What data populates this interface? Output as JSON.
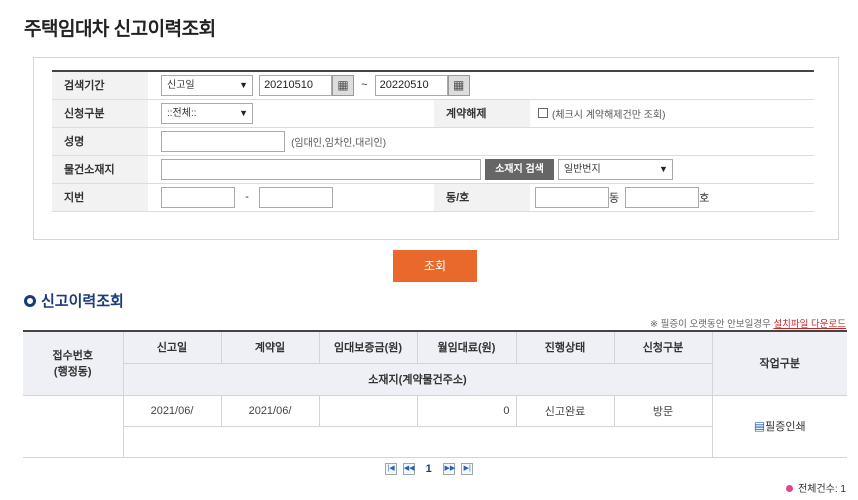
{
  "page_title": "주택임대차 신고이력조회",
  "search": {
    "period_label": "검색기간",
    "period_type": "신고일",
    "date_from": "20210510",
    "date_sep": "~",
    "date_to": "20220510",
    "req_type_label": "신청구분",
    "req_type_value": "::전체::",
    "cancel_label": "계약해제",
    "cancel_hint": "(체크시 계약해제건만 조회)",
    "name_label": "성명",
    "name_hint": "(임대인,임차인,대리인)",
    "address_label": "물건소재지",
    "address_search_button": "소재지 검색",
    "lot_type": "일반번지",
    "lot_label": "지번",
    "lot_sep": "-",
    "dong_ho_label": "동/호",
    "dong_suffix": "동",
    "ho_suffix": "호"
  },
  "search_button": "조회",
  "section_title": "신고이력조회",
  "notice": {
    "text": "※ 필증이 오랫동안 안보일경우",
    "link": "설치파일 다운로드"
  },
  "table": {
    "headers": {
      "receipt_no": "접수번호",
      "receipt_sub": "(행정동)",
      "report_date": "신고일",
      "contract_date": "계약일",
      "deposit": "임대보증금(원)",
      "monthly_rent": "월임대료(원)",
      "status": "진행상태",
      "req_type": "신청구분",
      "address": "소재지(계약물건주소)",
      "action": "작업구분"
    },
    "rows": [
      {
        "receipt_no": "",
        "report_date": "2021/06/",
        "contract_date": "2021/06/",
        "deposit": "",
        "monthly_rent": "0",
        "status": "신고완료",
        "req_type": "방문",
        "address": "",
        "action": "필증인쇄"
      }
    ]
  },
  "pager": {
    "first": "|◀",
    "prev": "◀◀",
    "current": "1",
    "next": "▶▶",
    "last": "▶|"
  },
  "total": "전체건수: 1",
  "colors": {
    "accent": "#e8692b",
    "section": "#1b3a7b",
    "link": "#c62828"
  }
}
